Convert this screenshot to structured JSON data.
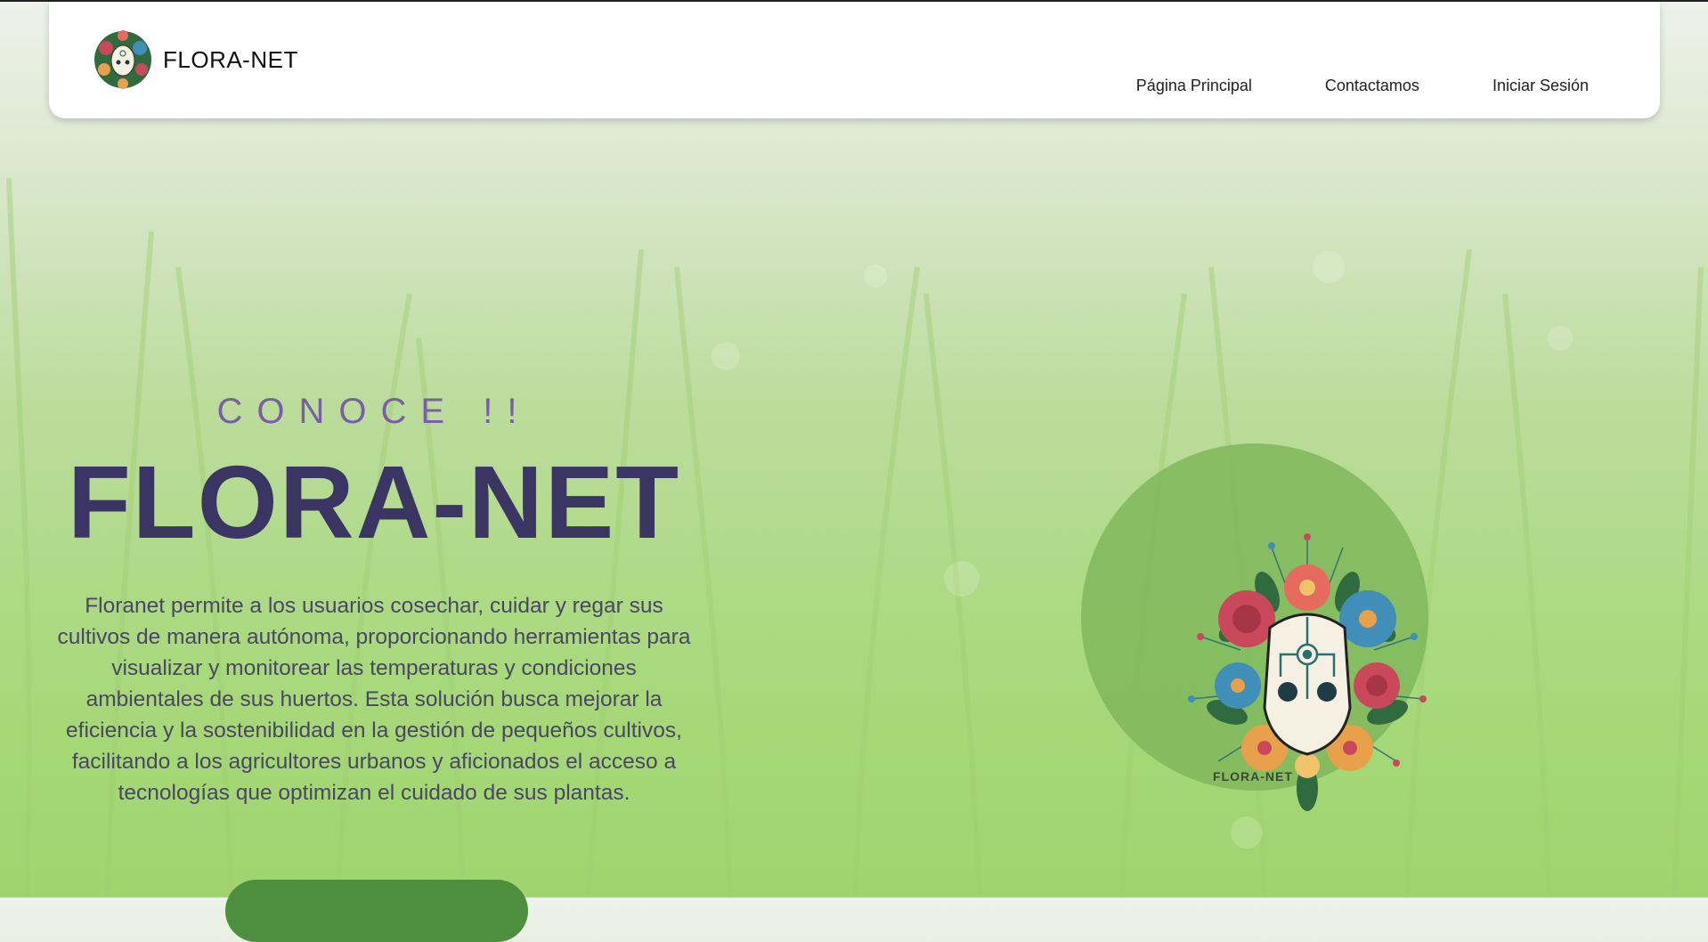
{
  "header": {
    "brand_name": "FLORA-NET",
    "nav": [
      "Página Principal",
      "Contactamos",
      "Iniciar Sesión"
    ]
  },
  "hero": {
    "kicker": "CONOCE !!",
    "title": "FLORA-NET",
    "description": "Floranet permite a los usuarios cosechar, cuidar y regar sus cultivos de manera autónoma, proporcionando herramientas para visualizar y monitorear las temperaturas y condiciones ambientales de sus huertos. Esta solución busca mejorar la eficiencia y la sostenibilidad en la gestión de pequeños cultivos, facilitando a los agricultores urbanos y aficionados el acceso a tecnologías que optimizan el cuidado de sus plantas.",
    "logo_caption": "FLORA-NET"
  },
  "icons": {
    "brand_logo": "flower-robot-mask-logo",
    "hero_logo": "flower-robot-mask-logo"
  },
  "colors": {
    "kicker": "#7b5ea8",
    "title": "#3a3563",
    "cta": "#4d8f3d",
    "circle": "#7fb75c"
  }
}
